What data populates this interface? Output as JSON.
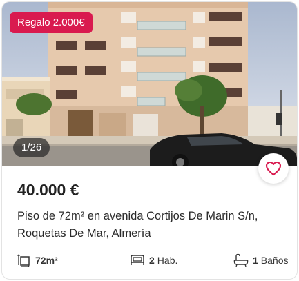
{
  "listing": {
    "badge": "Regalo 2.000€",
    "photo_counter": "1/26",
    "price": "40.000 €",
    "description": "Piso de 72m² en avenida Cortijos De Marin S/n, Roquetas De Mar, Almería",
    "favorite_icon": "heart-outline-icon",
    "features": {
      "area": {
        "icon": "area-icon",
        "value": "72m²"
      },
      "rooms": {
        "icon": "bed-icon",
        "value": "2",
        "unit": "Hab."
      },
      "baths": {
        "icon": "bathtub-icon",
        "value": "1",
        "unit": "Baños"
      }
    }
  },
  "colors": {
    "badge_bg": "#d91a4f",
    "favorite_heart": "#d91a4f",
    "price_text": "#222222"
  }
}
